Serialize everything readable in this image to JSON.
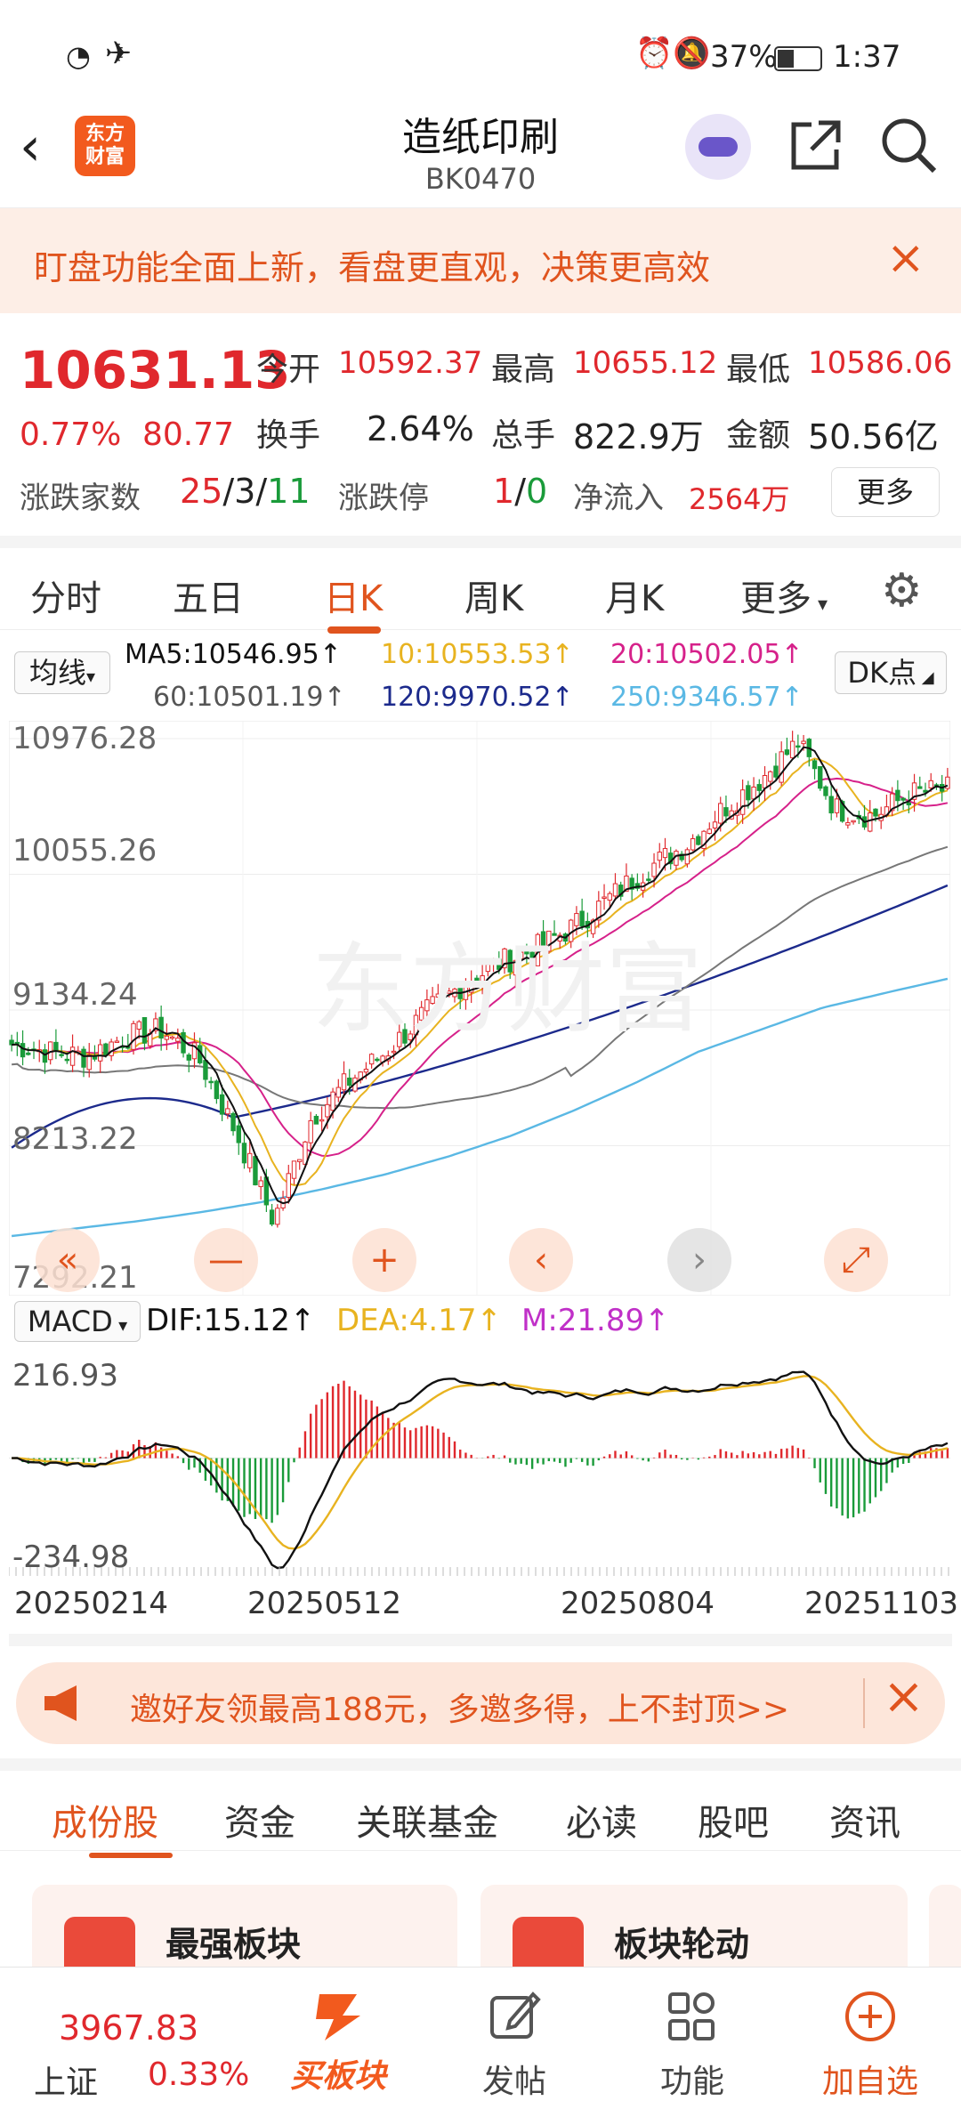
{
  "status_bar": {
    "battery": "37%",
    "time": "1:37"
  },
  "header": {
    "title": "造纸印刷",
    "code": "BK0470",
    "logo_text": "东方财富"
  },
  "notice": {
    "text": "盯盘功能全面上新，看盘更直观，决策更高效"
  },
  "quote": {
    "price": "10631.13",
    "change_pct": "0.77%",
    "change": "80.77",
    "open_label": "今开",
    "open": "10592.37",
    "high_label": "最高",
    "high": "10655.12",
    "low_label": "最低",
    "low": "10586.06",
    "turnover_label": "换手",
    "turnover": "2.64%",
    "volume_label": "总手",
    "volume": "822.9万",
    "amount_label": "金额",
    "amount": "50.56亿",
    "adv_label": "涨跌家数",
    "adv_up": "25",
    "adv_flat": "3",
    "adv_down": "11",
    "limit_label": "涨跌停",
    "limit_up": "1",
    "limit_down": "0",
    "inflow_label": "净流入",
    "inflow": "2564万",
    "more_label": "更多"
  },
  "ktabs": [
    "分时",
    "五日",
    "日K",
    "周K",
    "月K",
    "更多"
  ],
  "ma": {
    "selector": "均线",
    "ma5": "MA5:10546.95",
    "ma10": "10:10553.53",
    "ma20": "20:10502.05",
    "ma60": "60:10501.19",
    "ma120": "120:9970.52",
    "ma250": "250:9346.57",
    "dk": "DK点"
  },
  "macd": {
    "selector": "MACD",
    "dif": "DIF:15.12",
    "dea": "DEA:4.17",
    "m": "M:21.89"
  },
  "colors": {
    "up": "#e0282d",
    "down": "#1a9b3a",
    "accent": "#e0541e",
    "ma5": "#111111",
    "ma10": "#e8b320",
    "ma20": "#d6218a",
    "ma60": "#777777",
    "ma120": "#1c2a8c",
    "ma250": "#5ab8e4"
  },
  "chart_data": [
    {
      "type": "candlestick",
      "y_ticks": [
        "10976.28",
        "10055.26",
        "9134.24",
        "8213.22",
        "7292.21"
      ],
      "ylim": [
        7292.21,
        10976.28
      ],
      "x_tick_labels": [
        "20250214",
        "20250512",
        "20250804",
        "20251103"
      ],
      "close_trend": [
        8900,
        8850,
        8820,
        8950,
        9000,
        8800,
        8300,
        7700,
        8400,
        8650,
        8850,
        9100,
        9300,
        9450,
        9550,
        9700,
        9900,
        10100,
        10250,
        10500,
        10700,
        10950,
        10500,
        10450,
        10600,
        10631
      ],
      "ma250_trend": [
        7600,
        7650,
        7700,
        7760,
        7830,
        7920,
        8020,
        8140,
        8280,
        8450,
        8640,
        8850,
        9000,
        9150,
        9250,
        9346
      ]
    },
    {
      "type": "macd",
      "y_ticks": [
        "216.93",
        "-234.98"
      ],
      "ylim": [
        -234.98,
        216.93
      ]
    }
  ],
  "chart_controls": [
    "«",
    "—",
    "+",
    "‹",
    "›",
    "⤢"
  ],
  "promo": {
    "text": "邀好友领最高188元，多邀多得，上不封顶>>"
  },
  "bottom_tabs": [
    "成份股",
    "资金",
    "关联基金",
    "必读",
    "股吧",
    "资讯"
  ],
  "cards": [
    "最强板块",
    "板块轮动"
  ],
  "bottom_nav": {
    "index_value": "3967.83",
    "index_name": "上证",
    "index_change": "0.33%",
    "buy_label": "买板块",
    "post_label": "发帖",
    "func_label": "功能",
    "add_label": "加自选"
  }
}
